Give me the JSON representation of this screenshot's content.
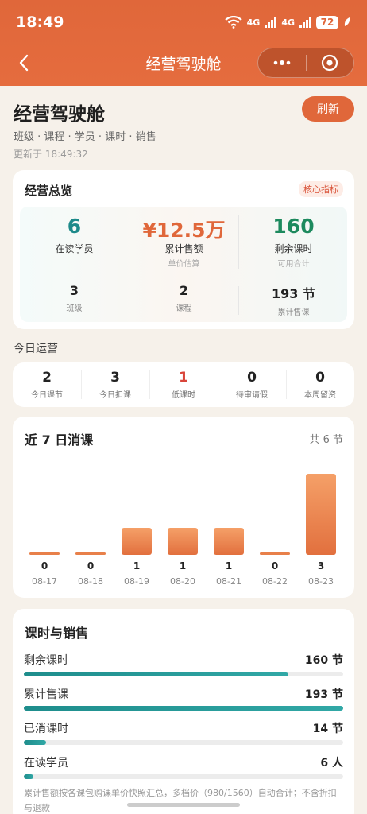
{
  "status_bar": {
    "time": "18:49",
    "network": "4G",
    "battery": "72"
  },
  "nav": {
    "title": "经营驾驶舱"
  },
  "page": {
    "title": "经营驾驶舱",
    "subtitle": "班级 · 课程 · 学员 · 课时 · 销售",
    "updated": "更新于 18:49:32",
    "refresh_label": "刷新"
  },
  "overview": {
    "title": "经营总览",
    "tag": "核心指标",
    "kpis": [
      {
        "value": "6",
        "label": "在读学员",
        "sub": "",
        "color": "#1d8a8a"
      },
      {
        "value": "¥12.5万",
        "label": "累计售额",
        "sub": "单价估算",
        "color": "#e0673a"
      },
      {
        "value": "160",
        "label": "剩余课时",
        "sub": "可用合计",
        "color": "#1d8a5e"
      }
    ],
    "minis": [
      {
        "value": "3",
        "label": "班级"
      },
      {
        "value": "2",
        "label": "课程"
      },
      {
        "value": "193 节",
        "label": "累计售课"
      }
    ]
  },
  "today": {
    "title": "今日运营",
    "items": [
      {
        "value": "2",
        "label": "今日课节",
        "color": "#222222"
      },
      {
        "value": "3",
        "label": "今日扣课",
        "color": "#222222"
      },
      {
        "value": "1",
        "label": "低课时",
        "color": "#d9453a"
      },
      {
        "value": "0",
        "label": "待审请假",
        "color": "#222222"
      },
      {
        "value": "0",
        "label": "本周留资",
        "color": "#222222"
      }
    ]
  },
  "chart_data": {
    "type": "bar",
    "title": "近 7 日消课",
    "total_label": "共 6 节",
    "categories": [
      "08-17",
      "08-18",
      "08-19",
      "08-20",
      "08-21",
      "08-22",
      "08-23"
    ],
    "values": [
      0,
      0,
      1,
      1,
      1,
      0,
      3
    ],
    "ylim": [
      0,
      3
    ],
    "grid": false,
    "bar_color": "#e8804a"
  },
  "sales": {
    "title": "课时与销售",
    "rows": [
      {
        "label": "剩余课时",
        "value": "160 节",
        "fraction": 0.829
      },
      {
        "label": "累计售课",
        "value": "193 节",
        "fraction": 1.0
      },
      {
        "label": "已消课时",
        "value": "14 节",
        "fraction": 0.07
      },
      {
        "label": "在读学员",
        "value": "6 人",
        "fraction": 0.03
      }
    ],
    "note": "累计售额按各课包购课单价快照汇总，多档价（980/1560）自动合计；不含折扣与退款"
  }
}
